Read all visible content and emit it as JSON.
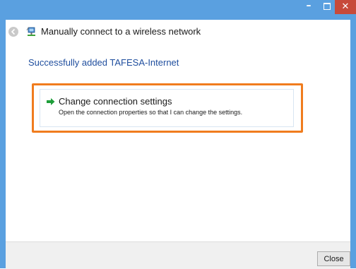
{
  "titlebar": {
    "minimize_glyph": "–",
    "close_glyph": "✕"
  },
  "header": {
    "title": "Manually connect to a wireless network",
    "back_icon": "back-arrow-icon",
    "network_icon": "wireless-network-icon"
  },
  "main": {
    "success_message": "Successfully added TAFESA-Internet",
    "option": {
      "title": "Change connection settings",
      "description": "Open the connection properties so that I can change the settings.",
      "icon": "green-arrow-icon"
    }
  },
  "footer": {
    "close_label": "Close"
  },
  "colors": {
    "titlebar": "#5aa0e0",
    "close_button": "#c74a3a",
    "accent_text": "#1f4e9e",
    "highlight": "#f07c1e",
    "arrow": "#1e9e3a"
  }
}
